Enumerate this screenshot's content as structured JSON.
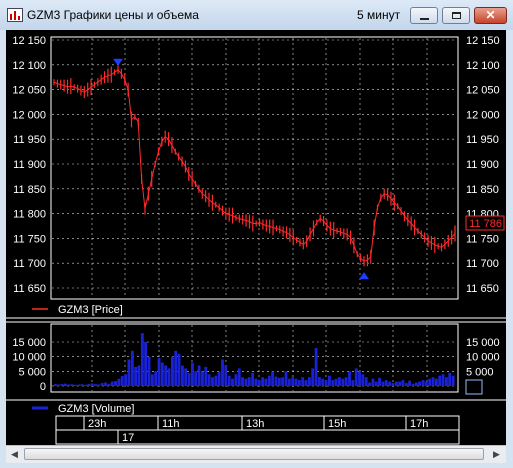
{
  "window": {
    "title": "GZM3 Графики цены и объема",
    "interval": "5 минут",
    "close_label": "✕"
  },
  "price_chart": {
    "y_ticks": [
      "12 150",
      "12 100",
      "12 050",
      "12 000",
      "11 950",
      "11 900",
      "11 850",
      "11 800",
      "11 750",
      "11 700",
      "11 650"
    ],
    "y_tick_values": [
      12150,
      12100,
      12050,
      12000,
      11950,
      11900,
      11850,
      11800,
      11750,
      11700,
      11650
    ],
    "ylim": [
      11630,
      12180
    ],
    "current_price_label": "11 786",
    "legend": "GZM3 [Price]",
    "series_color": "#ff2a2a",
    "marker_color": "#1c3cff"
  },
  "volume_chart": {
    "y_ticks": [
      "15 000",
      "10 000",
      "5 000",
      "0"
    ],
    "y_tick_values": [
      15000,
      10000,
      5000,
      0
    ],
    "ylim": [
      -1500,
      19500
    ],
    "legend": "GZM3 [Volume]",
    "series_color": "#1a22d8"
  },
  "time_axis": {
    "hour_labels": [
      "23h",
      "11h",
      "13h",
      "15h",
      "17h"
    ],
    "day_label": "17"
  },
  "chart_data": [
    {
      "type": "line",
      "title": "",
      "series": [
        {
          "name": "GZM3 [Price]",
          "values": [
            12065,
            12062,
            12060,
            12058,
            12056,
            12057,
            12055,
            12052,
            12048,
            12045,
            12050,
            12055,
            12060,
            12065,
            12070,
            12075,
            12078,
            12080,
            12085,
            12090,
            12082,
            12070,
            12050,
            11990,
            11995,
            11985,
            11870,
            11810,
            11840,
            11870,
            11900,
            11925,
            11945,
            11955,
            11950,
            11938,
            11925,
            11915,
            11905,
            11895,
            11880,
            11870,
            11860,
            11850,
            11840,
            11835,
            11828,
            11822,
            11818,
            11812,
            11806,
            11800,
            11798,
            11796,
            11792,
            11790,
            11788,
            11786,
            11784,
            11780,
            11780,
            11782,
            11778,
            11776,
            11774,
            11772,
            11770,
            11768,
            11764,
            11762,
            11757,
            11752,
            11747,
            11742,
            11738,
            11744,
            11758,
            11770,
            11782,
            11790,
            11785,
            11776,
            11770,
            11767,
            11765,
            11763,
            11760,
            11758,
            11752,
            11736,
            11718,
            11710,
            11704,
            11706,
            11713,
            11772,
            11812,
            11832,
            11840,
            11838,
            11830,
            11822,
            11815,
            11805,
            11795,
            11787,
            11780,
            11772,
            11765,
            11758,
            11752,
            11745,
            11741,
            11737,
            11734,
            11732,
            11738,
            11745,
            11752,
            11760
          ]
        }
      ],
      "markers": [
        {
          "label": "max",
          "value": 12100
        },
        {
          "label": "min",
          "value": 11680
        }
      ],
      "ylim": [
        11650,
        12150
      ],
      "xlabel": "",
      "ylabel": "",
      "x_labels": [
        "23h",
        "11h",
        "13h",
        "15h",
        "17h"
      ],
      "grid": true,
      "legend": "bottom-left"
    },
    {
      "type": "bar",
      "title": "",
      "series": [
        {
          "name": "GZM3 [Volume]",
          "values": [
            600,
            500,
            700,
            800,
            500,
            600,
            400,
            500,
            600,
            400,
            700,
            900,
            600,
            500,
            1000,
            1200,
            800,
            1500,
            1700,
            2500,
            3400,
            4000,
            9000,
            12000,
            6500,
            7000,
            18000,
            15000,
            10000,
            4000,
            5000,
            9500,
            8000,
            7000,
            6000,
            10000,
            12000,
            11000,
            7000,
            6000,
            4500,
            8000,
            5000,
            7000,
            5000,
            6500,
            4000,
            3000,
            3500,
            5000,
            9000,
            7000,
            3500,
            2500,
            4000,
            6000,
            3000,
            2500,
            3000,
            4500,
            2500,
            2000,
            3000,
            2500,
            3500,
            5000,
            3200,
            2800,
            3000,
            5000,
            2500,
            3000,
            2500,
            2000,
            3000,
            2000,
            3000,
            6000,
            13000,
            3000,
            2500,
            2000,
            3500,
            2000,
            2500,
            3000,
            2500,
            3000,
            5000,
            2000,
            6000,
            5000,
            4000,
            3000,
            1200,
            2500,
            1500,
            2800,
            1500,
            2000,
            1500,
            1000,
            1500,
            1500,
            2000,
            1000,
            1800,
            800,
            1200,
            1500,
            2000,
            1500,
            2500,
            3000,
            2500,
            3500,
            4000,
            3000,
            4500,
            3500
          ]
        }
      ],
      "ylim": [
        0,
        19000
      ],
      "xlabel": "",
      "ylabel": "",
      "grid": true,
      "legend": "bottom-left"
    }
  ]
}
